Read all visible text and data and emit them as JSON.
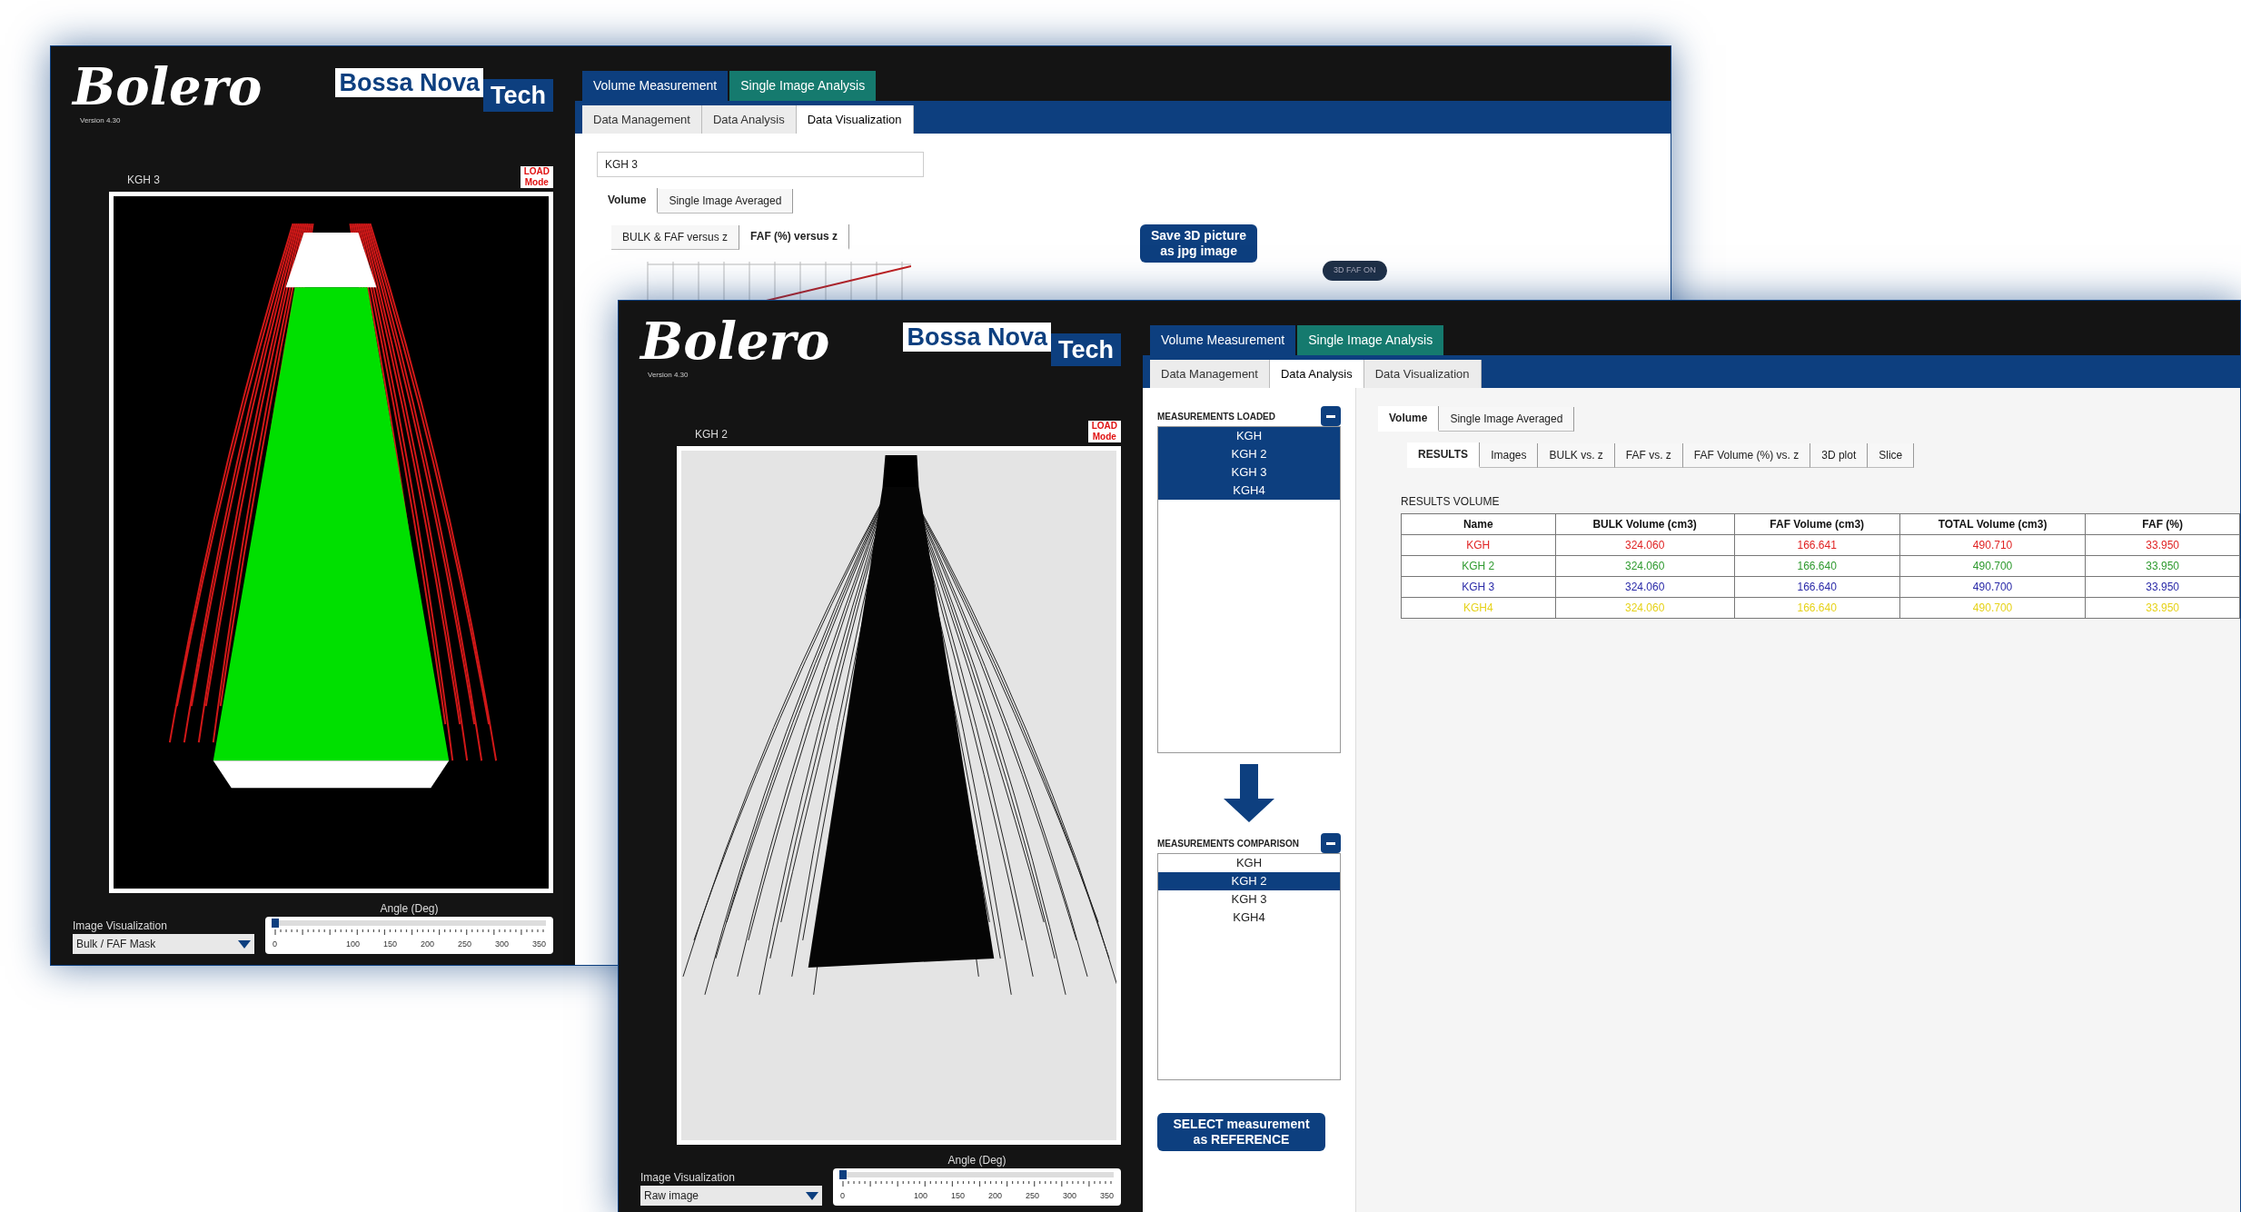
{
  "windows": [
    {
      "logo": "Bolero",
      "version": "Version 4.30",
      "brand": {
        "first": "Bossa Nova",
        "second": "Tech"
      },
      "image_label": "KGH 3",
      "mode_badge": [
        "LOAD",
        "Mode"
      ],
      "image": {
        "kind": "mask"
      },
      "visualization_label": "Image Visualization",
      "visualization_value": "Bulk / FAF Mask",
      "angle_label": "Angle (Deg)",
      "angle": {
        "level": 0.01
      },
      "angle_ticks": [
        "0",
        "100",
        "150",
        "200",
        "250",
        "300",
        "350"
      ],
      "main_tabs": [
        {
          "label": "Volume Measurement",
          "selected": true
        },
        {
          "label": "Single Image Analysis",
          "selected": false
        }
      ],
      "sub_tabs": [
        {
          "label": "Data Management",
          "selected": false
        },
        {
          "label": "Data Analysis",
          "selected": false
        },
        {
          "label": "Data Visualization",
          "selected": true
        }
      ],
      "content": {
        "kind": "visualization",
        "field_value": "KGH 3",
        "view_tabs": [
          {
            "label": "Volume",
            "selected": true
          },
          {
            "label": "Single Image Averaged",
            "selected": false
          }
        ],
        "plot_tabs": [
          {
            "label": "BULK & FAF versus z",
            "selected": false
          },
          {
            "label": "FAF (%) versus z",
            "selected": true
          }
        ],
        "save_button": [
          "Save 3D picture",
          "as jpg image"
        ],
        "toggle_button": "3D FAF ON"
      }
    },
    {
      "logo": "Bolero",
      "version": "Version 4.30",
      "brand": {
        "first": "Bossa Nova",
        "second": "Tech"
      },
      "image_label": "KGH 2",
      "mode_badge": [
        "LOAD",
        "Mode"
      ],
      "image": {
        "kind": "raw"
      },
      "visualization_label": "Image Visualization",
      "visualization_value": "Raw image",
      "angle_label": "Angle (Deg)",
      "angle": {
        "level": 0.01
      },
      "angle_ticks": [
        "0",
        "100",
        "150",
        "200",
        "250",
        "300",
        "350"
      ],
      "main_tabs": [
        {
          "label": "Volume Measurement",
          "selected": true
        },
        {
          "label": "Single Image Analysis",
          "selected": false
        }
      ],
      "sub_tabs": [
        {
          "label": "Data Management",
          "selected": false
        },
        {
          "label": "Data Analysis",
          "selected": true
        },
        {
          "label": "Data Visualization",
          "selected": false
        }
      ],
      "content": {
        "kind": "analysis",
        "loaded": {
          "title": "MEASUREMENTS LOADED",
          "items": [
            {
              "label": "KGH",
              "selected": true
            },
            {
              "label": "KGH 2",
              "selected": true
            },
            {
              "label": "KGH 3",
              "selected": true
            },
            {
              "label": "KGH4",
              "selected": true
            }
          ]
        },
        "compare": {
          "title": "MEASUREMENTS COMPARISON",
          "items": [
            {
              "label": "KGH",
              "selected": false
            },
            {
              "label": "KGH 2",
              "selected": true
            },
            {
              "label": "KGH 3",
              "selected": false
            },
            {
              "label": "KGH4",
              "selected": false
            }
          ]
        },
        "reference_button": [
          "SELECT measurement",
          "as REFERENCE"
        ],
        "view_tabs": [
          {
            "label": "Volume",
            "selected": true
          },
          {
            "label": "Single Image Averaged",
            "selected": false
          }
        ],
        "result_tabs": [
          {
            "label": "RESULTS",
            "selected": true
          },
          {
            "label": "Images",
            "selected": false
          },
          {
            "label": "BULK vs. z",
            "selected": false
          },
          {
            "label": "FAF vs. z",
            "selected": false
          },
          {
            "label": "FAF Volume (%) vs. z",
            "selected": false
          },
          {
            "label": "3D plot",
            "selected": false
          },
          {
            "label": "Slice",
            "selected": false
          }
        ],
        "table": {
          "title": "RESULTS VOLUME",
          "columns": [
            "Name",
            "BULK Volume (cm3)",
            "FAF Volume (cm3)",
            "TOTAL Volume (cm3)",
            "FAF (%)"
          ],
          "rows": [
            {
              "color": "#e02424",
              "cells": [
                "KGH",
                "324.060",
                "166.641",
                "490.710",
                "33.950"
              ]
            },
            {
              "color": "#2f9a2f",
              "cells": [
                "KGH 2",
                "324.060",
                "166.640",
                "490.700",
                "33.950"
              ]
            },
            {
              "color": "#2a2aa8",
              "cells": [
                "KGH 3",
                "324.060",
                "166.640",
                "490.700",
                "33.950"
              ]
            },
            {
              "color": "#e6d21a",
              "cells": [
                "KGH4",
                "324.060",
                "166.640",
                "490.700",
                "33.950"
              ]
            }
          ]
        }
      }
    }
  ]
}
